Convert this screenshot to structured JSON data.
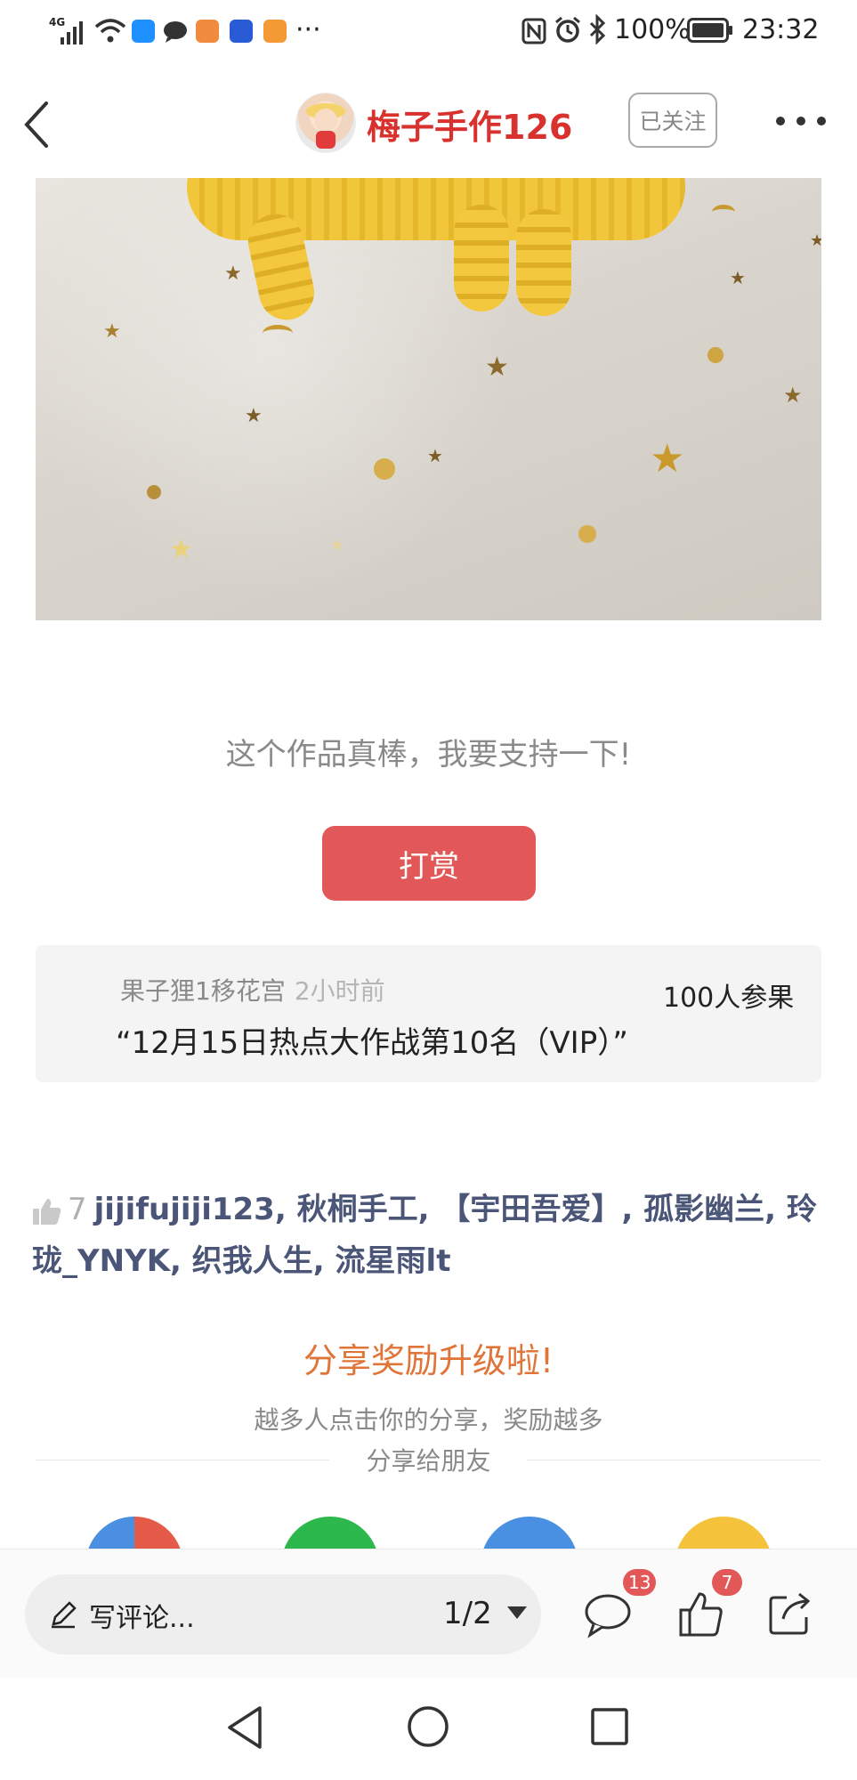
{
  "status_bar": {
    "network": "4G",
    "battery": "100%",
    "time": "23:32",
    "more_label": "···"
  },
  "header": {
    "author_name": "梅子手作126",
    "follow_label": "已关注"
  },
  "support": {
    "text": "这个作品真棒，我要支持一下!",
    "reward_button": "打赏"
  },
  "ranking_card": {
    "user": "果子狸1移花宫",
    "time": "2小时前",
    "participants": "100人参果",
    "title": "“12月15日热点大作战第10名（VIP）”"
  },
  "likes": {
    "count": "7",
    "names": [
      "jijifujiji123",
      "秋桐手工",
      "【宇田吾爱】",
      "孤影幽兰",
      "玲珑_YNYK",
      "织我人生",
      "流星雨lt"
    ],
    "text": "jijifujiji123, 秋桐手工, 【宇田吾爱】, 孤影幽兰, 玲珑_YNYK, 织我人生, 流星雨lt"
  },
  "share": {
    "title": "分享奖励升级啦!",
    "subtitle": "越多人点击你的分享，奖励越多",
    "friends_label": "分享给朋友",
    "icon_colors": [
      "#d8d8d8",
      "#2db84d",
      "#4a90e2",
      "#f5c33b"
    ]
  },
  "bottom_bar": {
    "comment_placeholder": "写评论...",
    "page_indicator": "1/2",
    "comment_badge": "13",
    "like_badge": "7"
  },
  "colors": {
    "accent_red": "#d9312d",
    "button_red": "#e25757",
    "share_orange": "#e0753a",
    "link_blue_gray": "#4a5578"
  }
}
